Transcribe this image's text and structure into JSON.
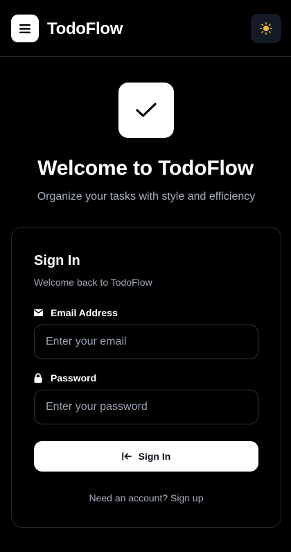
{
  "header": {
    "brand": "TodoFlow",
    "menu_icon": "hamburger-menu-icon",
    "theme_icon": "sun-icon"
  },
  "hero": {
    "icon": "checkmark-icon",
    "title": "Welcome to TodoFlow",
    "subtitle": "Organize your tasks with style and efficiency"
  },
  "card": {
    "title": "Sign In",
    "subtitle": "Welcome back to TodoFlow",
    "email": {
      "label": "Email Address",
      "icon": "mail-icon",
      "value": "",
      "placeholder": "Enter your email"
    },
    "password": {
      "label": "Password",
      "icon": "lock-icon",
      "value": "",
      "placeholder": "Enter your password"
    },
    "submit_label": "Sign In",
    "submit_icon": "sign-in-arrow-icon",
    "signup_text": "Need an account? Sign up"
  },
  "colors": {
    "background": "#000000",
    "surface_white": "#ffffff",
    "muted_text": "#a7afbd",
    "border": "#262a33",
    "theme_button_bg": "#141a26",
    "sun_accent": "#f5b93a"
  }
}
